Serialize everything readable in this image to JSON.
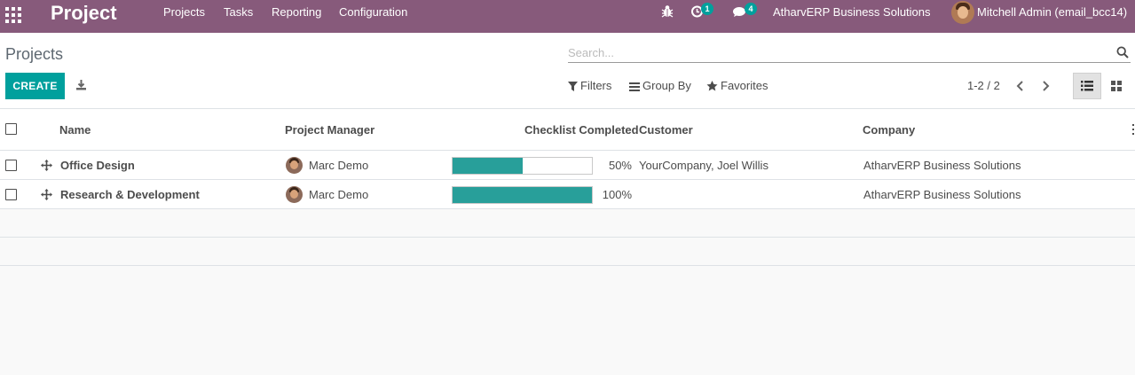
{
  "navbar": {
    "app_name": "Project",
    "menus": [
      "Projects",
      "Tasks",
      "Reporting",
      "Configuration"
    ],
    "activity_badge": "1",
    "messages_badge": "4",
    "company": "AtharvERP Business Solutions",
    "user": "Mitchell Admin (email_bcc14)"
  },
  "control_panel": {
    "breadcrumb": "Projects",
    "create_label": "CREATE",
    "search_placeholder": "Search...",
    "filters_label": "Filters",
    "group_by_label": "Group By",
    "favorites_label": "Favorites",
    "pager": "1-2 / 2"
  },
  "list": {
    "columns": [
      "Name",
      "Project Manager",
      "Checklist Completed",
      "Customer",
      "Company"
    ],
    "rows": [
      {
        "name": "Office Design",
        "manager": "Marc Demo",
        "checklist_percent": 50,
        "checklist_label": "50%",
        "customer": "YourCompany, Joel Willis",
        "company": "AtharvERP Business Solutions"
      },
      {
        "name": "Research & Development",
        "manager": "Marc Demo",
        "checklist_percent": 100,
        "checklist_label": "100%",
        "customer": "",
        "company": "AtharvERP Business Solutions"
      }
    ]
  },
  "colors": {
    "navbar": "#875a7b",
    "primary": "#00a09d",
    "progress": "#289f9a"
  }
}
